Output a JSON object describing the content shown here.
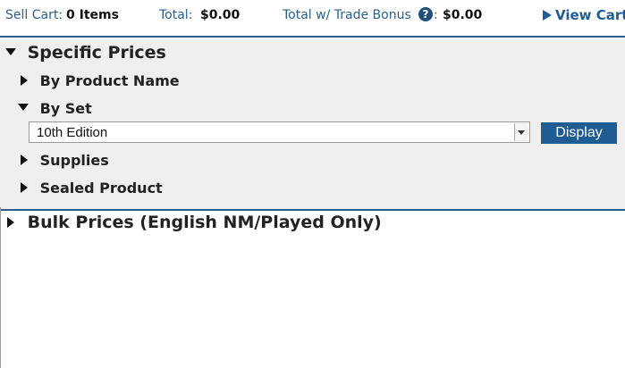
{
  "cart_bar": {
    "sell_cart_label": "Sell Cart:",
    "sell_cart_value": "0 Items",
    "total_label": "Total:",
    "total_value": "$0.00",
    "trade_bonus_label": "Total w/ Trade Bonus",
    "help_icon": "?",
    "trade_colon": ":",
    "trade_bonus_value": "$0.00",
    "view_cart_label": "View Cart"
  },
  "specific_prices": {
    "title": "Specific Prices",
    "expanded": true,
    "items": [
      {
        "label": "By Product Name",
        "expanded": false
      },
      {
        "label": "By Set",
        "expanded": true
      },
      {
        "label": "Supplies",
        "expanded": false
      },
      {
        "label": "Sealed Product",
        "expanded": false
      }
    ],
    "set_select": {
      "selected": "10th Edition"
    },
    "display_button": "Display"
  },
  "bulk_prices": {
    "title": "Bulk Prices (English NM/Played Only)",
    "expanded": false
  },
  "colors": {
    "accent": "#1f5c93",
    "panel_bg": "#efefef",
    "divider": "#2a5f8d"
  }
}
